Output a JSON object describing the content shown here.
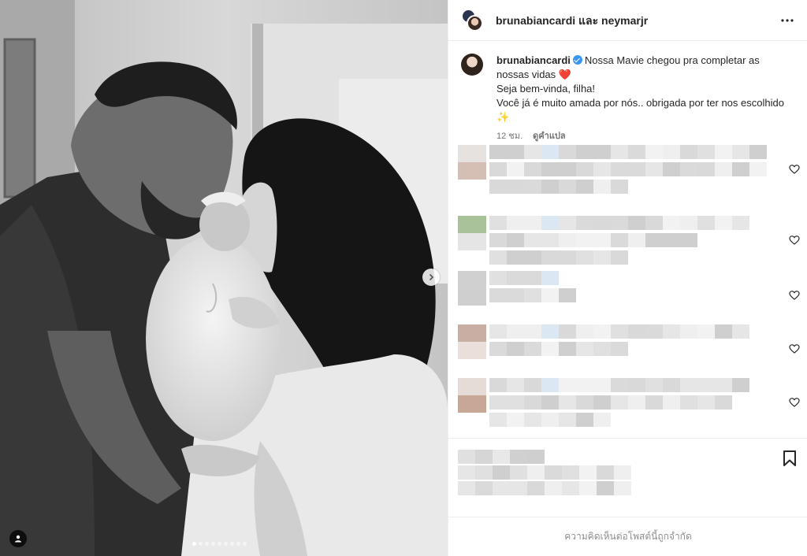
{
  "header": {
    "title": "brunabiancardi และ neymarjr",
    "more_icon": "more-horizontal-icon"
  },
  "caption": {
    "username": "brunabiancardi",
    "text": "Nossa Mavie chegou pra completar as nossas vidas ❤️",
    "line2": "Seja bem-vinda, filha!",
    "line3": "Você já é muito amada por nós.. obrigada por ter nos escolhido",
    "line4": "✨",
    "time": "12 ชม.",
    "translate": "ดูคำแปล"
  },
  "carousel": {
    "slide_count": 9,
    "active_index": 0
  },
  "comments": {
    "count_visible": 6,
    "note": ""
  },
  "footer": {
    "text": "ความคิดเห็นต่อโพสต์นี้ถูกจำกัด"
  },
  "colors": {
    "verified": "#3897f0",
    "border": "#efefef",
    "muted": "#737373"
  }
}
